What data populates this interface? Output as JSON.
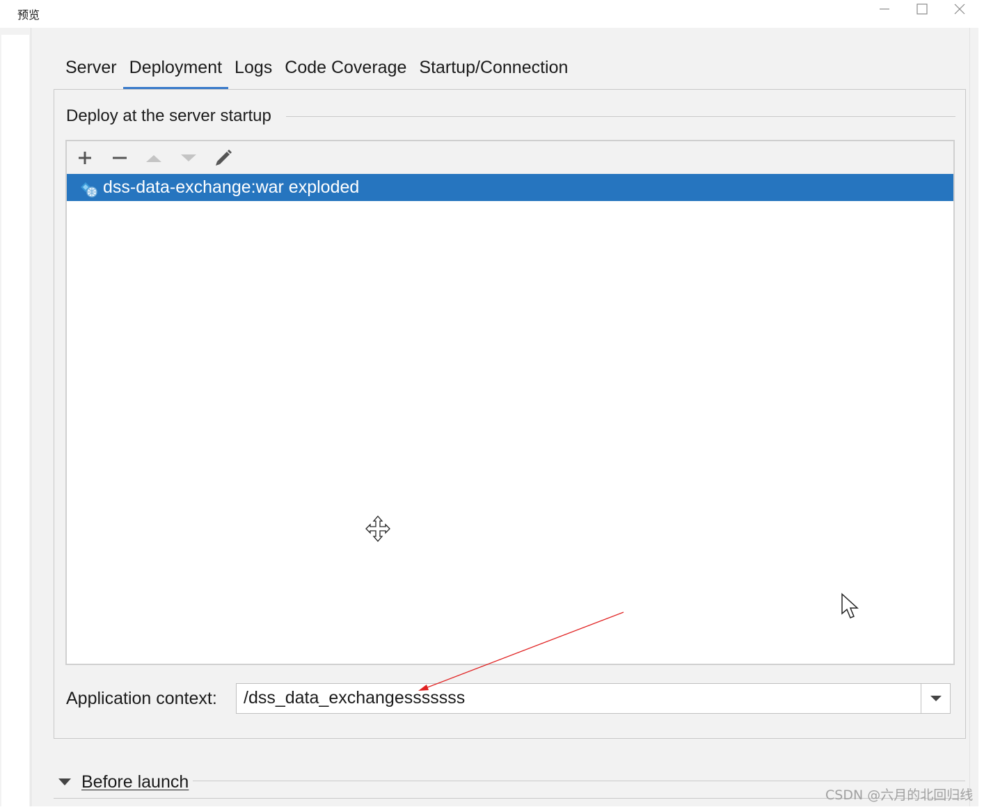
{
  "window": {
    "title": "预览"
  },
  "tabs": [
    {
      "label": "Server"
    },
    {
      "label": "Deployment",
      "active": true
    },
    {
      "label": "Logs"
    },
    {
      "label": "Code Coverage"
    },
    {
      "label": "Startup/Connection"
    }
  ],
  "deploy": {
    "section_title": "Deploy at the server startup",
    "toolbar": [
      "plus-icon",
      "minus-icon",
      "arrow-up-icon",
      "arrow-down-icon",
      "pencil-icon"
    ],
    "items": [
      {
        "label": "dss-data-exchange:war exploded",
        "icon": "artifact-icon",
        "selected": true
      }
    ]
  },
  "context": {
    "label": "Application context:",
    "value": "/dss_data_exchangesssssss"
  },
  "before_launch": {
    "label": "Before launch",
    "icon": "triangle-down-icon"
  },
  "watermark": "CSDN @六月的北回归线",
  "colors": {
    "selection": "#2675bf",
    "active_tab_underline": "#3678c9",
    "annotation_arrow": "#e02020",
    "panel_background": "#f2f2f2"
  }
}
